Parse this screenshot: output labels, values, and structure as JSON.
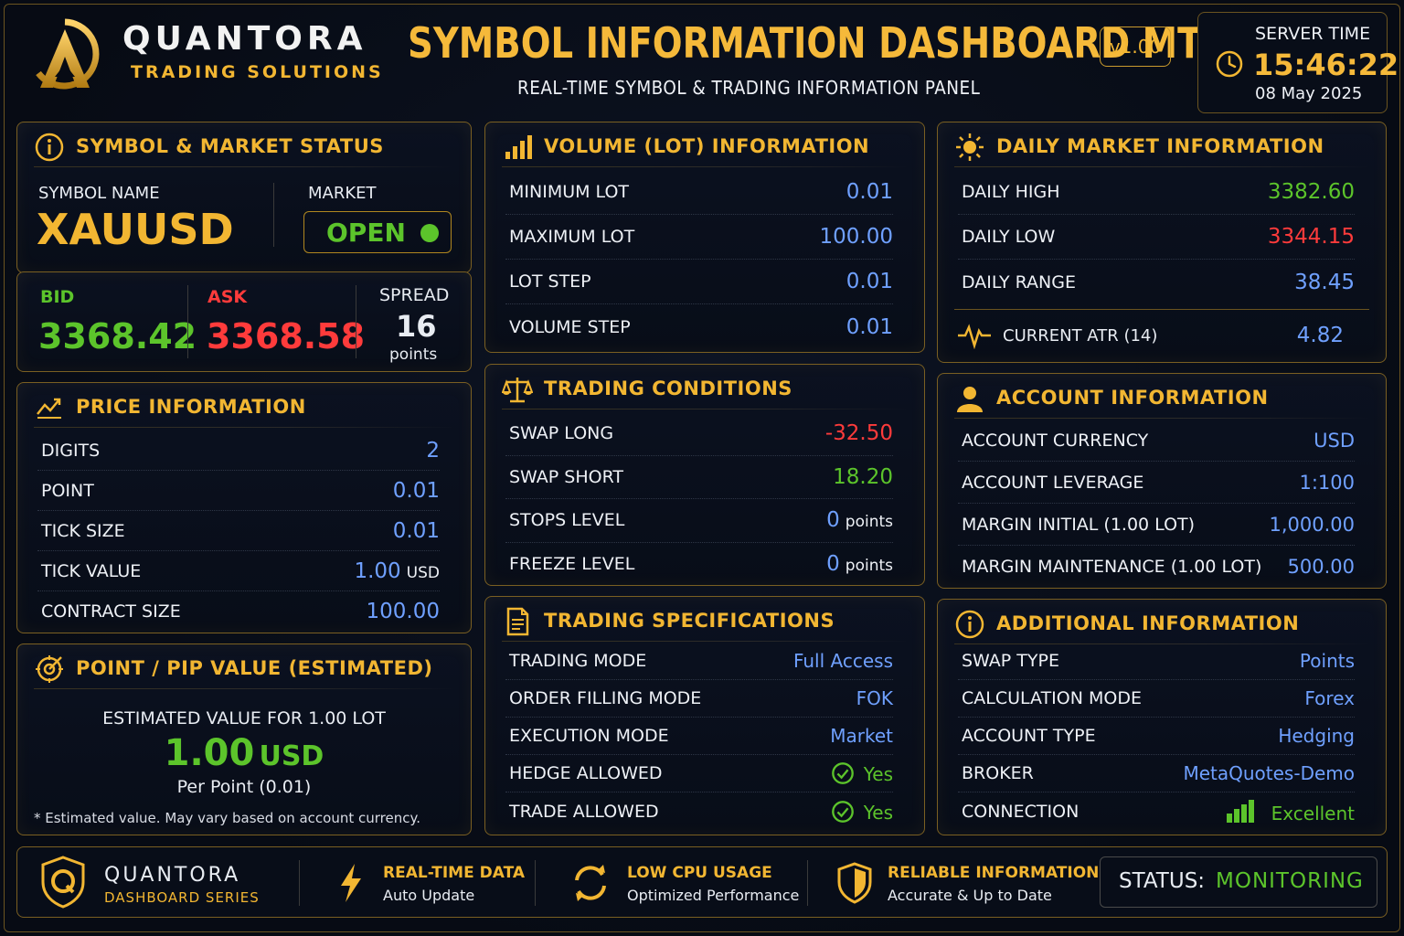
{
  "header": {
    "brand": "QUANTORA",
    "brand_sub": "TRADING SOLUTIONS",
    "title": "SYMBOL INFORMATION DASHBOARD MT5",
    "version": "v1.00",
    "subtitle": "REAL-TIME SYMBOL & TRADING INFORMATION PANEL",
    "server_label": "SERVER TIME",
    "server_time": "15:46:22",
    "server_date": "08 May 2025"
  },
  "symbol_status": {
    "title": "SYMBOL & MARKET STATUS",
    "symbol_label": "SYMBOL NAME",
    "symbol": "XAUUSD",
    "market_label": "MARKET",
    "market_status": "OPEN",
    "bid_label": "BID",
    "bid": "3368.42",
    "ask_label": "ASK",
    "ask": "3368.58",
    "spread_label": "SPREAD",
    "spread": "16",
    "spread_unit": "points"
  },
  "price_info": {
    "title": "PRICE INFORMATION",
    "rows": [
      {
        "label": "DIGITS",
        "value": "2",
        "unit": ""
      },
      {
        "label": "POINT",
        "value": "0.01",
        "unit": ""
      },
      {
        "label": "TICK SIZE",
        "value": "0.01",
        "unit": ""
      },
      {
        "label": "TICK VALUE",
        "value": "1.00",
        "unit": "USD"
      },
      {
        "label": "CONTRACT SIZE",
        "value": "100.00",
        "unit": ""
      }
    ]
  },
  "pip_value": {
    "title": "POINT / PIP VALUE (ESTIMATED)",
    "label": "ESTIMATED VALUE FOR 1.00 LOT",
    "value": "1.00",
    "currency": "USD",
    "per": "Per Point (0.01)",
    "note": "* Estimated value. May vary based on account currency."
  },
  "volume": {
    "title": "VOLUME (LOT) INFORMATION",
    "rows": [
      {
        "label": "MINIMUM LOT",
        "value": "0.01"
      },
      {
        "label": "MAXIMUM LOT",
        "value": "100.00"
      },
      {
        "label": "LOT STEP",
        "value": "0.01"
      },
      {
        "label": "VOLUME STEP",
        "value": "0.01"
      }
    ]
  },
  "conditions": {
    "title": "TRADING CONDITIONS",
    "rows": [
      {
        "label": "SWAP LONG",
        "value": "-32.50",
        "unit": ""
      },
      {
        "label": "SWAP SHORT",
        "value": "18.20",
        "unit": ""
      },
      {
        "label": "STOPS LEVEL",
        "value": "0",
        "unit": "points"
      },
      {
        "label": "FREEZE LEVEL",
        "value": "0",
        "unit": "points"
      }
    ]
  },
  "specs": {
    "title": "TRADING SPECIFICATIONS",
    "rows": [
      {
        "label": "TRADING MODE",
        "value": "Full Access"
      },
      {
        "label": "ORDER FILLING MODE",
        "value": "FOK"
      },
      {
        "label": "EXECUTION MODE",
        "value": "Market"
      },
      {
        "label": "HEDGE ALLOWED",
        "value": "Yes"
      },
      {
        "label": "TRADE ALLOWED",
        "value": "Yes"
      }
    ]
  },
  "daily": {
    "title": "DAILY MARKET INFORMATION",
    "rows": [
      {
        "label": "DAILY HIGH",
        "value": "3382.60"
      },
      {
        "label": "DAILY LOW",
        "value": "3344.15"
      },
      {
        "label": "DAILY RANGE",
        "value": "38.45"
      }
    ],
    "atr_label": "CURRENT ATR (14)",
    "atr_value": "4.82"
  },
  "account": {
    "title": "ACCOUNT INFORMATION",
    "rows": [
      {
        "label": "ACCOUNT CURRENCY",
        "value": "USD"
      },
      {
        "label": "ACCOUNT LEVERAGE",
        "value": "1:100"
      },
      {
        "label": "MARGIN INITIAL (1.00 LOT)",
        "value": "1,000.00"
      },
      {
        "label": "MARGIN MAINTENANCE (1.00 LOT)",
        "value": "500.00"
      }
    ]
  },
  "additional": {
    "title": "ADDITIONAL INFORMATION",
    "rows": [
      {
        "label": "SWAP TYPE",
        "value": "Points"
      },
      {
        "label": "CALCULATION MODE",
        "value": "Forex"
      },
      {
        "label": "ACCOUNT TYPE",
        "value": "Hedging"
      },
      {
        "label": "BROKER",
        "value": "MetaQuotes-Demo"
      },
      {
        "label": "CONNECTION",
        "value": "Excellent"
      }
    ]
  },
  "footer": {
    "brand": "QUANTORA",
    "brand_sub": "DASHBOARD SERIES",
    "f1_title": "REAL-TIME DATA",
    "f1_sub": "Auto Update",
    "f2_title": "LOW CPU USAGE",
    "f2_sub": "Optimized Performance",
    "f3_title": "RELIABLE INFORMATION",
    "f3_sub": "Accurate & Up to Date",
    "status_label": "STATUS:",
    "status_value": "MONITORING"
  },
  "colors": {
    "gold": "#f2b632",
    "green": "#5cc42b",
    "red": "#ff3b3b",
    "blue": "#6fa0ff",
    "background": "#070b14"
  }
}
